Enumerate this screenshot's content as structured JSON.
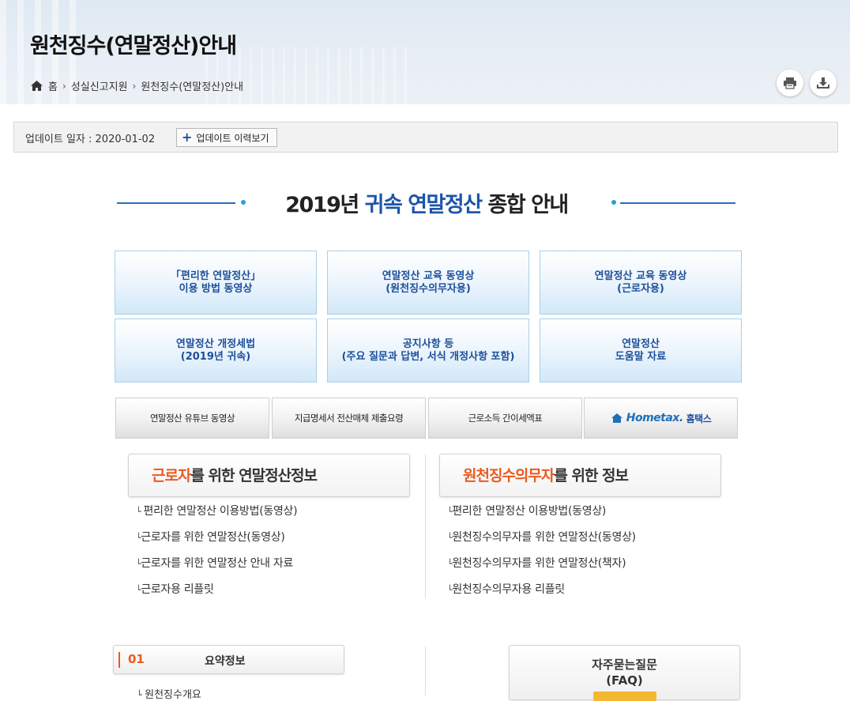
{
  "header": {
    "title": "원천징수(연말정산)안내",
    "breadcrumb": [
      "홈",
      "성실신고지원",
      "원천징수(연말정산)안내"
    ],
    "icons": [
      "home-icon",
      "print-icon",
      "download-icon"
    ]
  },
  "update": {
    "label": "업데이트 일자 : 2020-01-02",
    "button_label": "업데이트 이력보기"
  },
  "main_heading": {
    "year": "2019년",
    "highlight": "귀속 연말정산",
    "suffix": "종합 안내"
  },
  "tiles": [
    "「편리한 연말정산」\n이용 방법 동영상",
    "연말정산 교육 동영상\n(원천징수의무자용)",
    "연말정산 교육 동영상\n(근로자용)",
    "연말정산 개정세법\n(2019년 귀속)",
    "공지사항 등\n(주요 질문과 답변, 서식 개정사항 포함)",
    "연말정산\n도움말 자료"
  ],
  "gray_buttons": [
    "연말정산 유튜브 동영상",
    "지급명세서 전산매체 제출요령",
    "근로소득 간이세액표"
  ],
  "hometax": {
    "logo": "Hometax.",
    "label": "홈택스"
  },
  "worker_section": {
    "title_highlight": "근로자",
    "title_rest": "를 위한 연말정산정보",
    "links": [
      "편리한 연말정산 이용방법(동영상)",
      "근로자를 위한 연말정산(동영상)",
      "근로자를 위한 연말정산 안내 자료",
      "근로자용 리플릿"
    ]
  },
  "withholder_section": {
    "title_highlight": "원천징수의무자",
    "title_rest": "를 위한 정보",
    "links": [
      "편리한 연말정산 이용방법(동영상)",
      "원천징수의무자를 위한 연말정산(동영상)",
      "원천징수의무자를 위한 연말정산(책자)",
      "원천징수의무자용 리플릿"
    ]
  },
  "summary": {
    "number": "01",
    "title": "요약정보",
    "first_item": "원천징수개요"
  },
  "faq": {
    "line1": "자주묻는질문",
    "line2": "(FAQ)"
  },
  "colors": {
    "accent_blue": "#1d55a8",
    "accent_orange": "#ec5a1f",
    "tile_border": "#a9d0ea"
  }
}
